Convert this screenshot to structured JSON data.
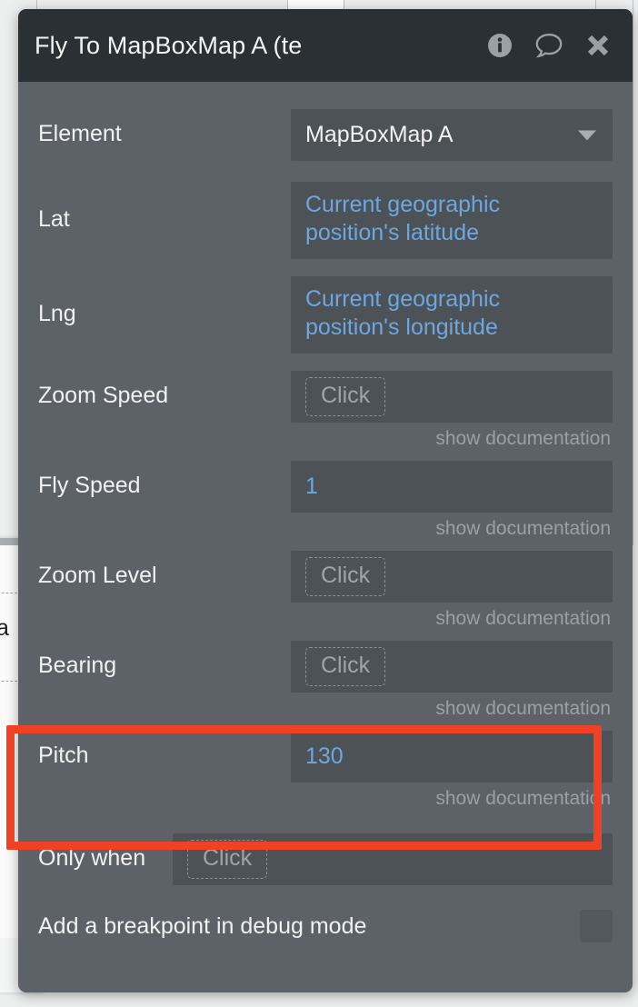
{
  "window": {
    "title": "Fly To MapBoxMap A (te",
    "icons": {
      "info": "info-icon",
      "comment": "comment-icon",
      "close": "close-icon"
    }
  },
  "background": {
    "partial_text": "a"
  },
  "fields": [
    {
      "label": "Element",
      "type": "dropdown",
      "value": "MapBoxMap A",
      "value_style": "plain",
      "doc": null,
      "lines": 1
    },
    {
      "label": "Lat",
      "type": "expression",
      "value": "Current geographic position's latitude",
      "value_style": "dynamic",
      "doc": null,
      "lines": 2
    },
    {
      "label": "Lng",
      "type": "expression",
      "value": "Current geographic position's longitude",
      "value_style": "dynamic",
      "doc": null,
      "lines": 2
    },
    {
      "label": "Zoom Speed",
      "type": "empty",
      "placeholder": "Click",
      "doc": "show documentation",
      "lines": 1
    },
    {
      "label": "Fly Speed",
      "type": "expression",
      "value": "1",
      "value_style": "dynamic",
      "doc": "show documentation",
      "lines": 1
    },
    {
      "label": "Zoom Level",
      "type": "empty",
      "placeholder": "Click",
      "doc": "show documentation",
      "lines": 1
    },
    {
      "label": "Bearing",
      "type": "empty",
      "placeholder": "Click",
      "doc": "show documentation",
      "lines": 1
    },
    {
      "label": "Pitch",
      "type": "expression",
      "value": "130",
      "value_style": "dynamic",
      "doc": "show documentation",
      "lines": 1,
      "highlighted": true
    }
  ],
  "only_when": {
    "label": "Only when",
    "placeholder": "Click"
  },
  "breakpoint": {
    "label": "Add a breakpoint in debug mode",
    "checked": false
  },
  "colors": {
    "panel_bg": "#5d6268",
    "titlebar_bg": "#2b3034",
    "field_bg": "#4d5257",
    "dynamic_text": "#6ca7e0",
    "highlight": "#f04124"
  }
}
